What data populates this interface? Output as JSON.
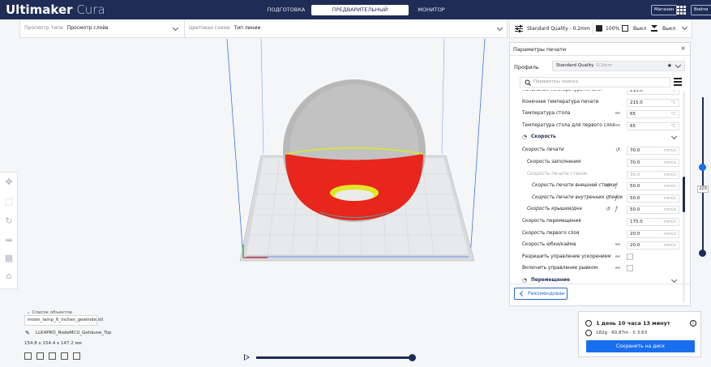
{
  "app": {
    "name_bold": "Ultimaker",
    "name_light": "Cura"
  },
  "stages": [
    {
      "label": "ПОДГОТОВКА",
      "active": false
    },
    {
      "label": "ПРЕДВАРИТЕЛЬНЫЙ ПРОСМОТР",
      "active": true
    },
    {
      "label": "МОНИТОР",
      "active": false
    }
  ],
  "header": {
    "marketplace_label": "Магазин",
    "login_label": "Войти"
  },
  "view": {
    "type_label": "Просмотр типа",
    "type_value": "Просмотр слоёв",
    "scheme_label": "Цветовая схема",
    "scheme_value": "Тип линии"
  },
  "quick": {
    "profile": "Standard Quality - 0.2mm",
    "infill": "100%",
    "support": "Выкл",
    "adhesion": "Выкл"
  },
  "panel": {
    "title": "Параметры печати",
    "profile_label": "Профиль",
    "profile_value": "Standard Quality",
    "profile_sub": "0.2mm",
    "search_placeholder": "Параметры поиска",
    "recommended_label": "Рекомендован",
    "settings": [
      {
        "label": "Начальная температура печати",
        "value": "210.0",
        "unit": "°C",
        "indent": 0,
        "icons": []
      },
      {
        "label": "Конечная температура печати",
        "value": "215.0",
        "unit": "°C",
        "indent": 0,
        "icons": []
      },
      {
        "label": "Температура стола",
        "value": "65",
        "unit": "°C",
        "indent": 0,
        "icons": [
          "link"
        ]
      },
      {
        "label": "Температура стола для первого слоя",
        "value": "65",
        "unit": "°C",
        "indent": 0,
        "icons": [
          "link"
        ]
      },
      {
        "label": "Скорость",
        "section": true
      },
      {
        "label": "Скорость печати",
        "value": "70.0",
        "unit": "mm/s",
        "indent": 0,
        "icons": [
          "reset"
        ],
        "italic": true
      },
      {
        "label": "Скорость заполнения",
        "value": "70.0",
        "unit": "mm/s",
        "indent": 1,
        "icons": []
      },
      {
        "label": "Скорость печати стенок",
        "value": "35.0",
        "unit": "mm/s",
        "indent": 1,
        "icons": [],
        "disabled": true
      },
      {
        "label": "Скорость печати внешней стенки",
        "value": "50.0",
        "unit": "mm/s",
        "indent": 2,
        "icons": [
          "reset",
          "fx"
        ],
        "italic": true
      },
      {
        "label": "Скорость печати внутренних стенок",
        "value": "50.0",
        "unit": "mm/s",
        "indent": 2,
        "icons": [
          "reset",
          "fx"
        ],
        "italic": true
      },
      {
        "label": "Скорость крышки/дна",
        "value": "50.0",
        "unit": "mm/s",
        "indent": 1,
        "icons": [
          "reset",
          "fx"
        ],
        "italic": true
      },
      {
        "label": "Скорость перемещения",
        "value": "175.0",
        "unit": "mm/s",
        "indent": 0,
        "icons": []
      },
      {
        "label": "Скорость первого слоя",
        "value": "20.0",
        "unit": "mm/s",
        "indent": 0,
        "icons": []
      },
      {
        "label": "Скорость юбки/кайма",
        "value": "20.0",
        "unit": "mm/s",
        "indent": 0,
        "icons": [
          "link"
        ]
      },
      {
        "label": "Разрешить управление ускорением",
        "checkbox": true,
        "indent": 0,
        "icons": [
          "link"
        ]
      },
      {
        "label": "Включить управление рывком",
        "checkbox": true,
        "indent": 0,
        "icons": [
          "link"
        ]
      },
      {
        "label": "Перемещение",
        "section": true
      }
    ]
  },
  "layer": {
    "current": "220",
    "position": 0.55
  },
  "objects": {
    "list_label": "Список объектов",
    "file": "moon_lamp_6_inches_gewinde.stl",
    "machine": "LLK4PRO_NodeMCU_Gehäuse_Top",
    "dimensions": "154.8 x 154.4 x 147.2 мм"
  },
  "output": {
    "time": "1 день 10 часа 13 минут",
    "material": "182g · 60.87m · € 3.63",
    "save_label": "Сохранить на диск"
  },
  "colors": {
    "header": "#1f2c56",
    "accent": "#196ef0",
    "model_red": "#e8261c",
    "model_yellow": "#e0e825",
    "shell": "#c0c0c0"
  }
}
